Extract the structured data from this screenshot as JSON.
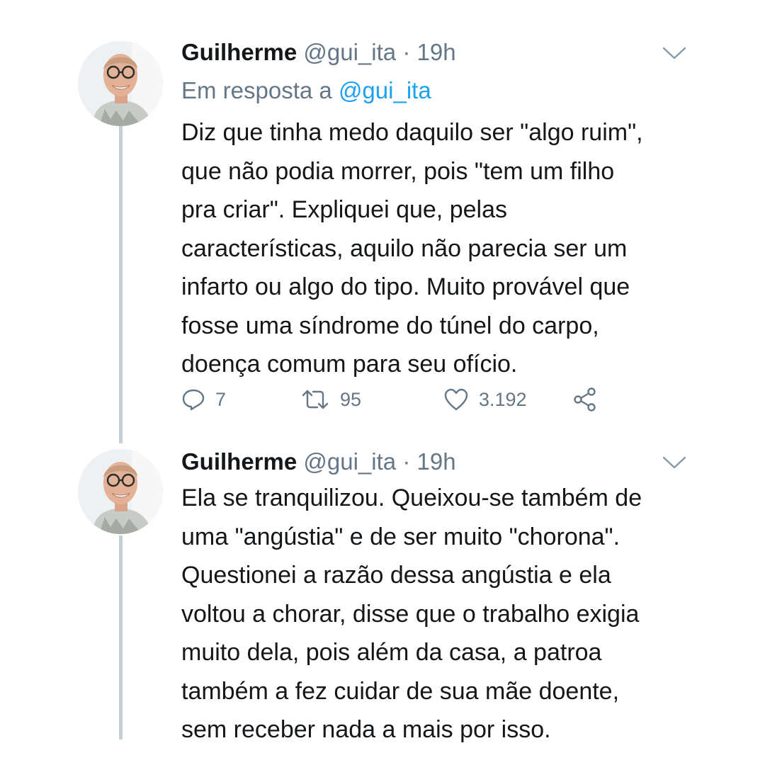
{
  "tweets": [
    {
      "name": "Guilherme",
      "handle": "@gui_ita",
      "separator": "·",
      "time": "19h",
      "reply_prefix": "Em resposta a",
      "reply_handle": "@gui_ita",
      "lines": [
        "Diz que tinha medo daquilo ser \"algo ruim\",",
        "que não podia morrer, pois \"tem um filho",
        "pra criar\". Expliquei que, pelas",
        "características, aquilo não parecia ser um",
        "infarto ou algo do tipo. Muito provável que",
        "fosse uma síndrome do túnel do carpo,",
        "doença comum para seu ofício."
      ],
      "replies": "7",
      "retweets": "95",
      "likes": "3.192"
    },
    {
      "name": "Guilherme",
      "handle": "@gui_ita",
      "separator": "·",
      "time": "19h",
      "lines": [
        "Ela se tranquilizou. Queixou-se também de",
        "uma \"angústia\" e de ser muito \"chorona\".",
        "Questionei a razão dessa angústia e ela",
        "voltou a chorar, disse que o trabalho exigia",
        "muito dela, pois além da casa, a patroa",
        "também a fez cuidar de sua mãe doente,",
        "sem receber nada a mais por isso."
      ]
    }
  ],
  "icons": {
    "reply": "reply-icon",
    "retweet": "retweet-icon",
    "like": "heart-icon",
    "share": "share-icon",
    "menu": "chevron-down-icon"
  },
  "colors": {
    "text": "#14171a",
    "muted": "#657786",
    "link": "#1da1f2",
    "thread_line": "#c4cfd6"
  }
}
